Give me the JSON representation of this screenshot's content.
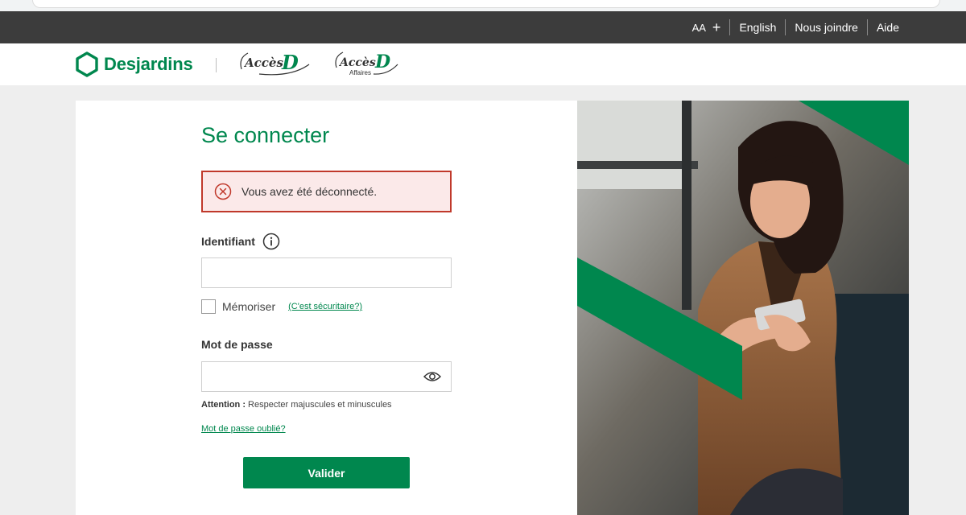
{
  "header": {
    "font_size_label": "AA",
    "font_plus": "+",
    "language_link": "English",
    "contact_link": "Nous joindre",
    "help_link": "Aide"
  },
  "brand": {
    "name": "Desjardins",
    "acces_d": "AccèsD",
    "acces_d_affaires": "AccèsD",
    "affaires": "Affaires"
  },
  "login": {
    "title": "Se connecter",
    "alert_message": "Vous avez été déconnecté.",
    "identifier_label": "Identifiant",
    "identifier_value": "",
    "remember_label": "Mémoriser",
    "secure_link": "(C'est sécuritaire?)",
    "password_label": "Mot de passe",
    "password_value": "",
    "attention_prefix": "Attention :",
    "attention_text": " Respecter majuscules et minuscules",
    "forgot_link": "Mot de passe oublié?",
    "submit_label": "Valider"
  },
  "colors": {
    "brand_green": "#00874e",
    "utility_bar": "#3c3c3c",
    "alert_border": "#c0392b",
    "alert_bg": "#fbe9e9"
  },
  "icons": [
    "desjardins-hexagon-icon",
    "error-x-icon",
    "info-icon",
    "eye-icon"
  ]
}
